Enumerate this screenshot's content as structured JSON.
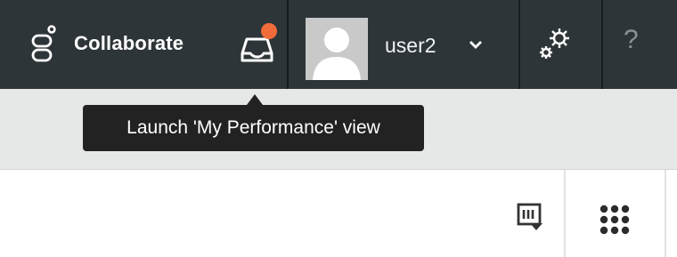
{
  "header": {
    "collaborate_label": "Collaborate",
    "username": "user2",
    "help_glyph": "?"
  },
  "tooltip": {
    "text": "Launch 'My Performance' view"
  },
  "icons": {
    "collaborate": "collaborate-icon",
    "performance": "inbox-tray-icon",
    "notification": "notification-badge",
    "avatar": "user-avatar-placeholder",
    "caret": "chevron-down-icon",
    "settings": "gears-icon",
    "help": "question-mark-icon",
    "export": "export-report-icon",
    "apps": "app-grid-icon"
  },
  "colors": {
    "header_bg": "#2e3539",
    "subbar_bg": "#e6e8e8",
    "badge": "#f26b3a",
    "tooltip_bg": "#222222"
  }
}
